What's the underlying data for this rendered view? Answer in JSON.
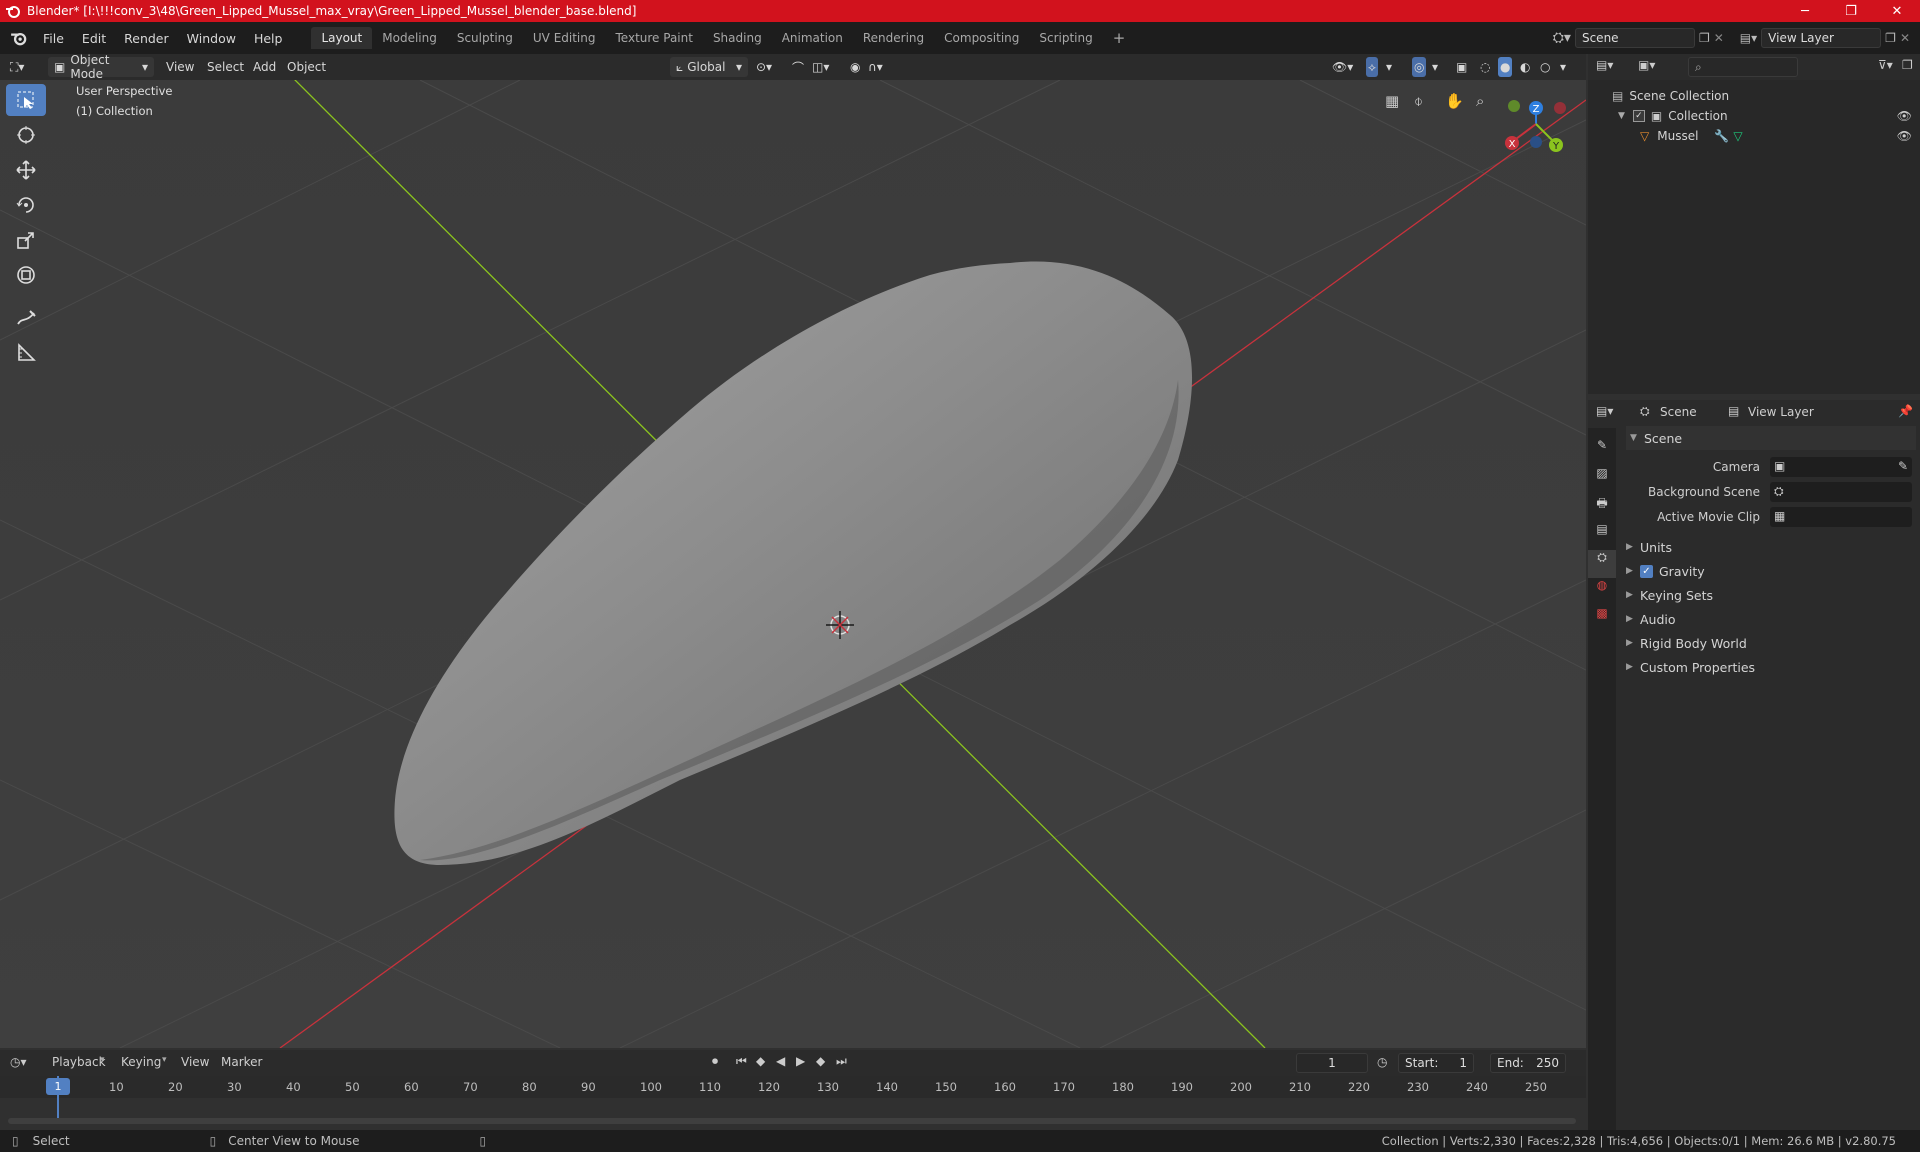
{
  "window": {
    "title": "Blender* [I:\\!!!conv_3\\48\\Green_Lipped_Mussel_max_vray\\Green_Lipped_Mussel_blender_base.blend]",
    "minimize": "─",
    "maximize": "❐",
    "close": "✕"
  },
  "menu": [
    "File",
    "Edit",
    "Render",
    "Window",
    "Help"
  ],
  "workspaces": [
    "Layout",
    "Modeling",
    "Sculpting",
    "UV Editing",
    "Texture Paint",
    "Shading",
    "Animation",
    "Rendering",
    "Compositing",
    "Scripting"
  ],
  "active_workspace": "Layout",
  "scene_field": "Scene",
  "viewlayer_field": "View Layer",
  "viewport_header": {
    "mode": "Object Mode",
    "menus": [
      "View",
      "Select",
      "Add",
      "Object"
    ],
    "orientation": "Global"
  },
  "viewport": {
    "perspective": "User Perspective",
    "collection": "(1) Collection",
    "gizmo": {
      "x": "X",
      "y": "Y",
      "z": "Z"
    }
  },
  "outliner": {
    "search_placeholder": "",
    "rows": [
      {
        "label": "Scene Collection"
      },
      {
        "label": "Collection"
      },
      {
        "label": "Mussel"
      }
    ]
  },
  "properties": {
    "tabs": {
      "scene": "Scene",
      "view_layer": "View Layer"
    },
    "panel_title": "Scene",
    "fields": [
      {
        "label": "Camera",
        "value": ""
      },
      {
        "label": "Background Scene",
        "value": ""
      },
      {
        "label": "Active Movie Clip",
        "value": ""
      }
    ],
    "sections": [
      "Units",
      "Gravity",
      "Keying Sets",
      "Audio",
      "Rigid Body World",
      "Custom Properties"
    ],
    "gravity_checked": true
  },
  "timeline": {
    "menus": [
      "Playback",
      "Keying",
      "View",
      "Marker"
    ],
    "current_frame": "1",
    "start_label": "Start:",
    "start": "1",
    "end_label": "End:",
    "end": "250",
    "ticks": [
      "1",
      "10",
      "20",
      "30",
      "40",
      "50",
      "60",
      "70",
      "80",
      "90",
      "100",
      "110",
      "120",
      "130",
      "140",
      "150",
      "160",
      "170",
      "180",
      "190",
      "200",
      "210",
      "220",
      "230",
      "240",
      "250"
    ]
  },
  "status": {
    "left": "Select",
    "middle": "Center View to Mouse",
    "right": "Collection | Verts:2,330 | Faces:2,328 | Tris:4,656 | Objects:0/1 | Mem: 26.6 MB | v2.80.75"
  },
  "colors": {
    "titlebar": "#d2121d",
    "accent": "#5280c2",
    "axis_x": "#c8323c",
    "axis_y": "#8bc41e",
    "axis_z": "#2e7fe0"
  }
}
